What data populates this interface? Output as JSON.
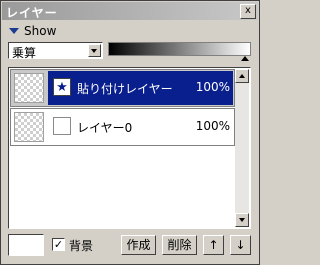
{
  "window": {
    "title": "レイヤー",
    "close_glyph": "x"
  },
  "show": {
    "label": "Show"
  },
  "blend_mode": {
    "value": "乗算"
  },
  "opacity_slider": {
    "value": 1.0
  },
  "layers": [
    {
      "name": "貼り付けレイヤー",
      "opacity": "100%",
      "selected": true,
      "mark_glyph": "★"
    },
    {
      "name": "レイヤー0",
      "opacity": "100%",
      "selected": false,
      "mark_glyph": ""
    }
  ],
  "footer": {
    "background_label": "背景",
    "background_checked": true,
    "check_glyph": "✓",
    "create_label": "作成",
    "delete_label": "削除",
    "up_label": "↑",
    "down_label": "↓"
  },
  "colors": {
    "selection": "#0a1f8e",
    "panel": "#d4d0c8"
  }
}
